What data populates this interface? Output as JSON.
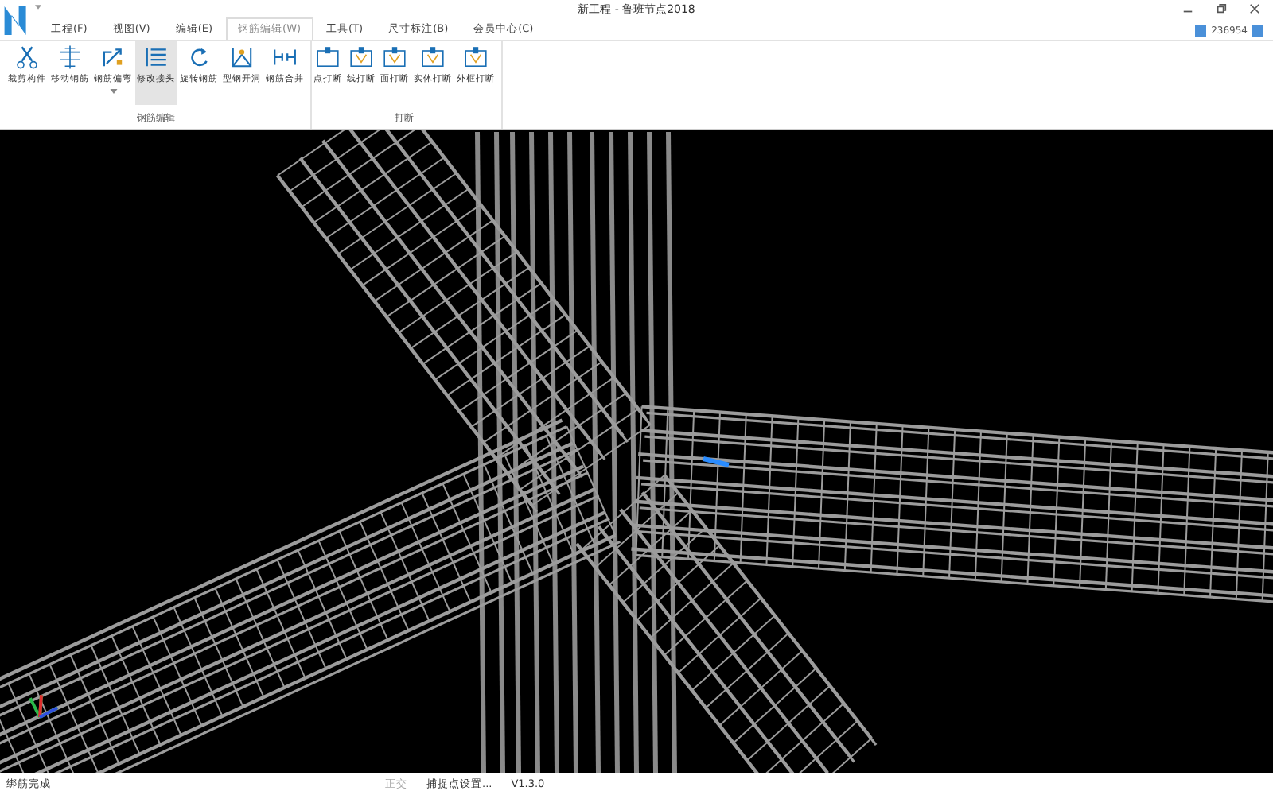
{
  "window": {
    "title": "新工程 - 鲁班节点2018",
    "user_id": "236954"
  },
  "tabs": [
    {
      "label": "工程(F)",
      "selected": false
    },
    {
      "label": "视图(V)",
      "selected": false
    },
    {
      "label": "编辑(E)",
      "selected": false
    },
    {
      "label": "钢筋编辑(W)",
      "selected": true
    },
    {
      "label": "工具(T)",
      "selected": false
    },
    {
      "label": "尺寸标注(B)",
      "selected": false
    },
    {
      "label": "会员中心(C)",
      "selected": false
    }
  ],
  "ribbon_groups": [
    {
      "label": "钢筋编辑",
      "buttons": [
        {
          "label": "裁剪构件",
          "kind": "scissors",
          "selected": false,
          "dropdown": false
        },
        {
          "label": "移动钢筋",
          "kind": "move",
          "selected": false,
          "dropdown": false
        },
        {
          "label": "钢筋偏弯",
          "kind": "bend",
          "selected": false,
          "dropdown": true
        },
        {
          "label": "修改接头",
          "kind": "list",
          "selected": true,
          "dropdown": false
        },
        {
          "label": "旋转钢筋",
          "kind": "rotate",
          "selected": false,
          "dropdown": false
        },
        {
          "label": "型钢开洞",
          "kind": "hole",
          "selected": false,
          "dropdown": false
        },
        {
          "label": "钢筋合并",
          "kind": "merge",
          "selected": false,
          "dropdown": false
        }
      ]
    },
    {
      "label": "打断",
      "buttons": [
        {
          "label": "点打断",
          "kind": "point",
          "selected": false,
          "dropdown": false
        },
        {
          "label": "线打断",
          "kind": "line",
          "selected": false,
          "dropdown": false
        },
        {
          "label": "面打断",
          "kind": "face",
          "selected": false,
          "dropdown": false
        },
        {
          "label": "实体打断",
          "kind": "solid",
          "selected": false,
          "dropdown": false
        },
        {
          "label": "外框打断",
          "kind": "frame",
          "selected": false,
          "dropdown": false
        }
      ]
    }
  ],
  "status_bar": {
    "message": "绑筋完成",
    "ortho": {
      "label": "正交",
      "on": false
    },
    "snap": "捕捉点设置...",
    "version": "V1.3.0"
  }
}
